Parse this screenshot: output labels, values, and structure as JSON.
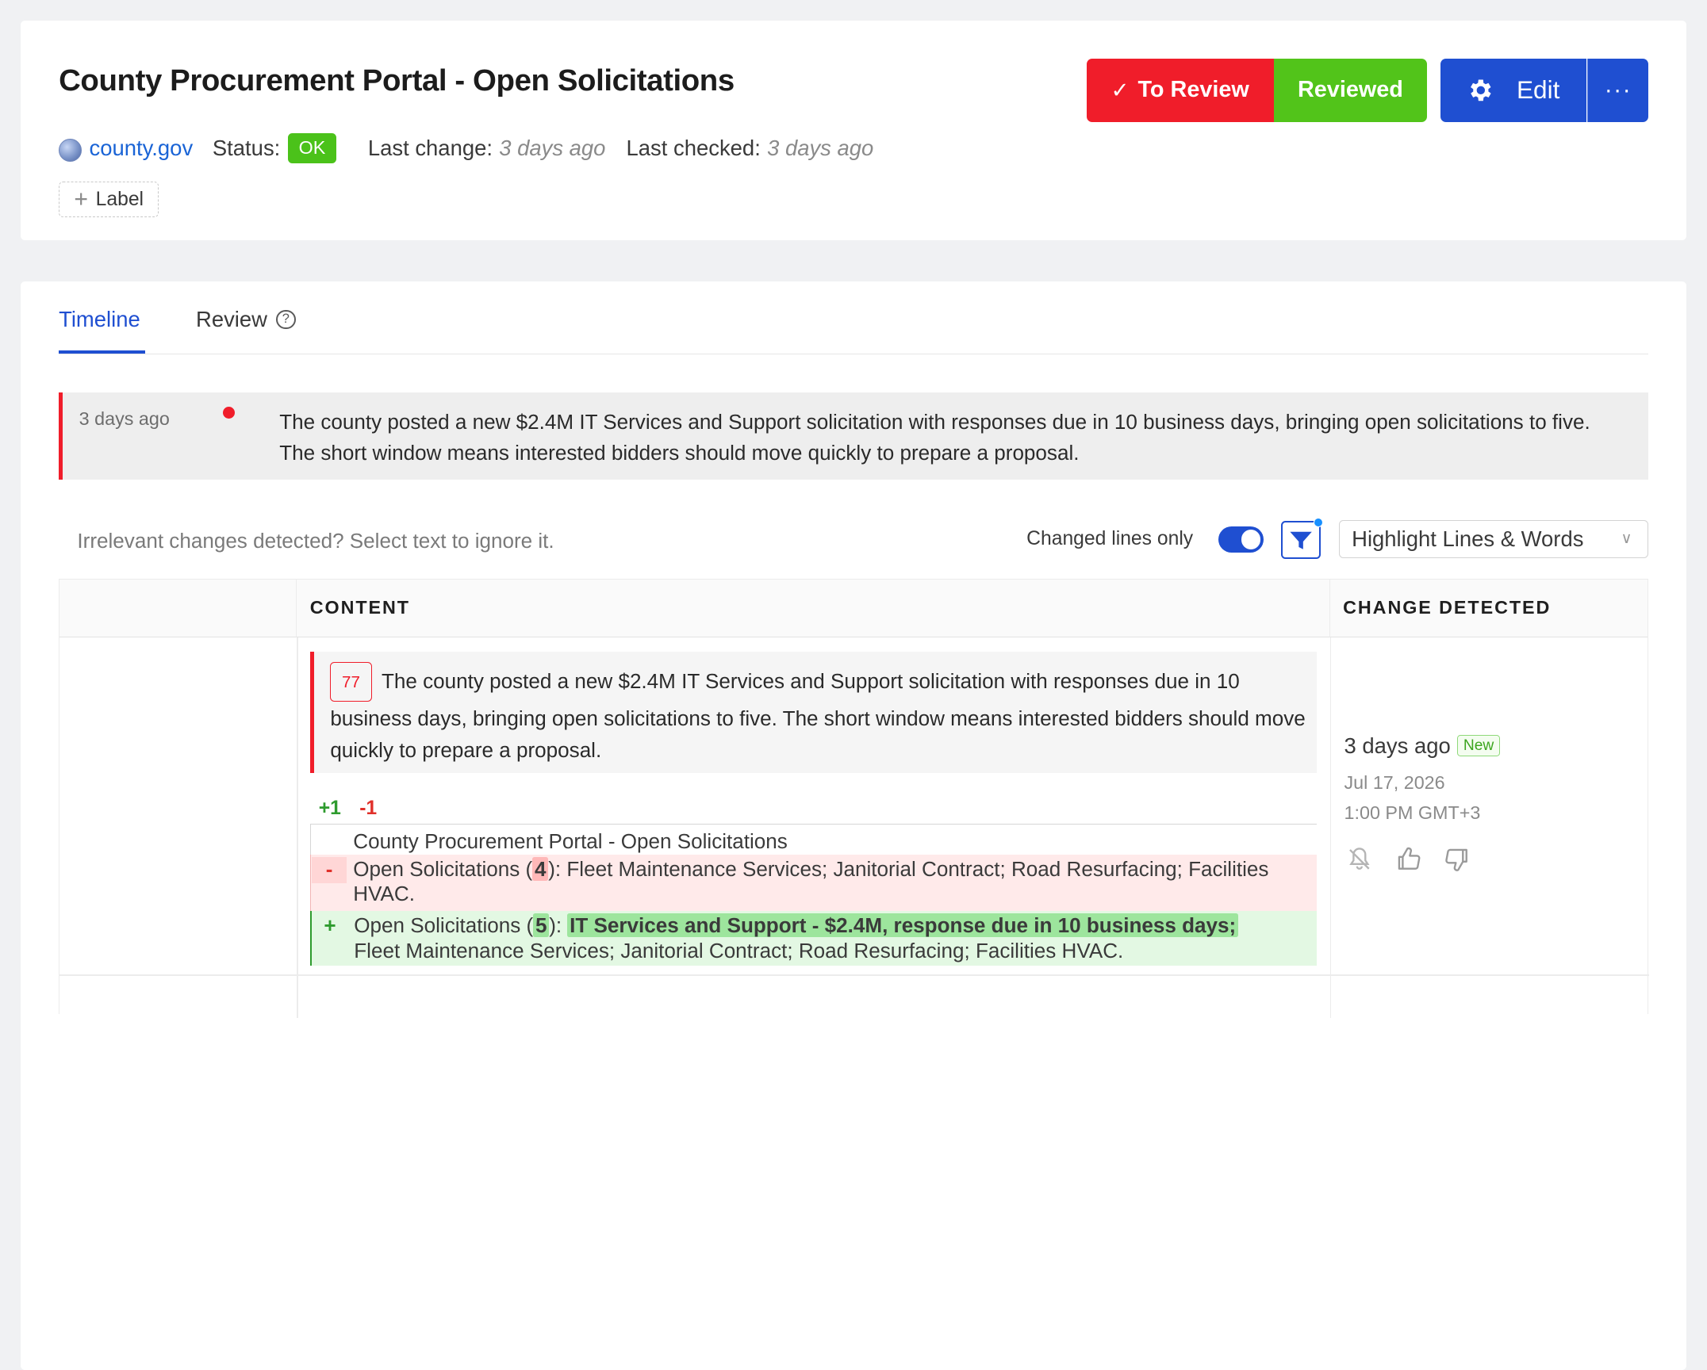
{
  "header": {
    "title": "County Procurement Portal - Open Solicitations",
    "site": "county.gov",
    "status_label": "Status:",
    "status_value": "OK",
    "last_change_label": "Last change:",
    "last_change_value": "3 days ago",
    "last_checked_label": "Last checked:",
    "last_checked_value": "3 days ago",
    "add_label": "Label",
    "to_review_label": "To Review",
    "reviewed_label": "Reviewed",
    "edit_label": "Edit",
    "more_label": "···"
  },
  "tabs": [
    {
      "label": "Timeline",
      "active": true
    },
    {
      "label": "Review",
      "active": false
    }
  ],
  "summary": {
    "time": "3 days ago",
    "text": "The county posted a new $2.4M IT Services and Support solicitation with responses due in 10 business days, bringing open solicitations to five. The short window means interested bidders should move quickly to prepare a proposal."
  },
  "toolbar": {
    "hint": "Irrelevant changes detected? Select text to ignore it.",
    "changed_only_label": "Changed lines only",
    "changed_only_on": true,
    "highlight_mode": "Highlight Lines & Words"
  },
  "table": {
    "columns": [
      "",
      "CONTENT",
      "CHANGE DETECTED"
    ],
    "row": {
      "count": "77",
      "change_text": "The county posted a new $2.4M IT Services and Support solicitation with responses due in 10 business days, bringing open solicitations to five. The short window means interested bidders should move quickly to prepare a proposal.",
      "added_count": "+1",
      "removed_count": "-1",
      "diff": {
        "context": "County Procurement Portal - Open Solicitations",
        "removed_prefix": "Open Solicitations (",
        "removed_word": "4",
        "removed_rest": "): Fleet Maintenance Services; Janitorial Contract; Road Resurfacing; Facilities HVAC.",
        "added_prefix": "Open Solicitations (",
        "added_word": "5",
        "added_mid": "): ",
        "added_highlight": "IT Services and Support - $2.4M, response due in 10 business days;",
        "added_rest": " Fleet Maintenance Services; Janitorial Contract; Road Resurfacing; Facilities HVAC."
      },
      "detected_relative": "3 days ago",
      "new_badge": "New",
      "detected_date": "Jul 17, 2026",
      "detected_time": "1:00 PM GMT+3"
    }
  },
  "colors": {
    "accent_blue": "#1f4fd1",
    "red": "#f01d2a",
    "green": "#52c41a"
  }
}
